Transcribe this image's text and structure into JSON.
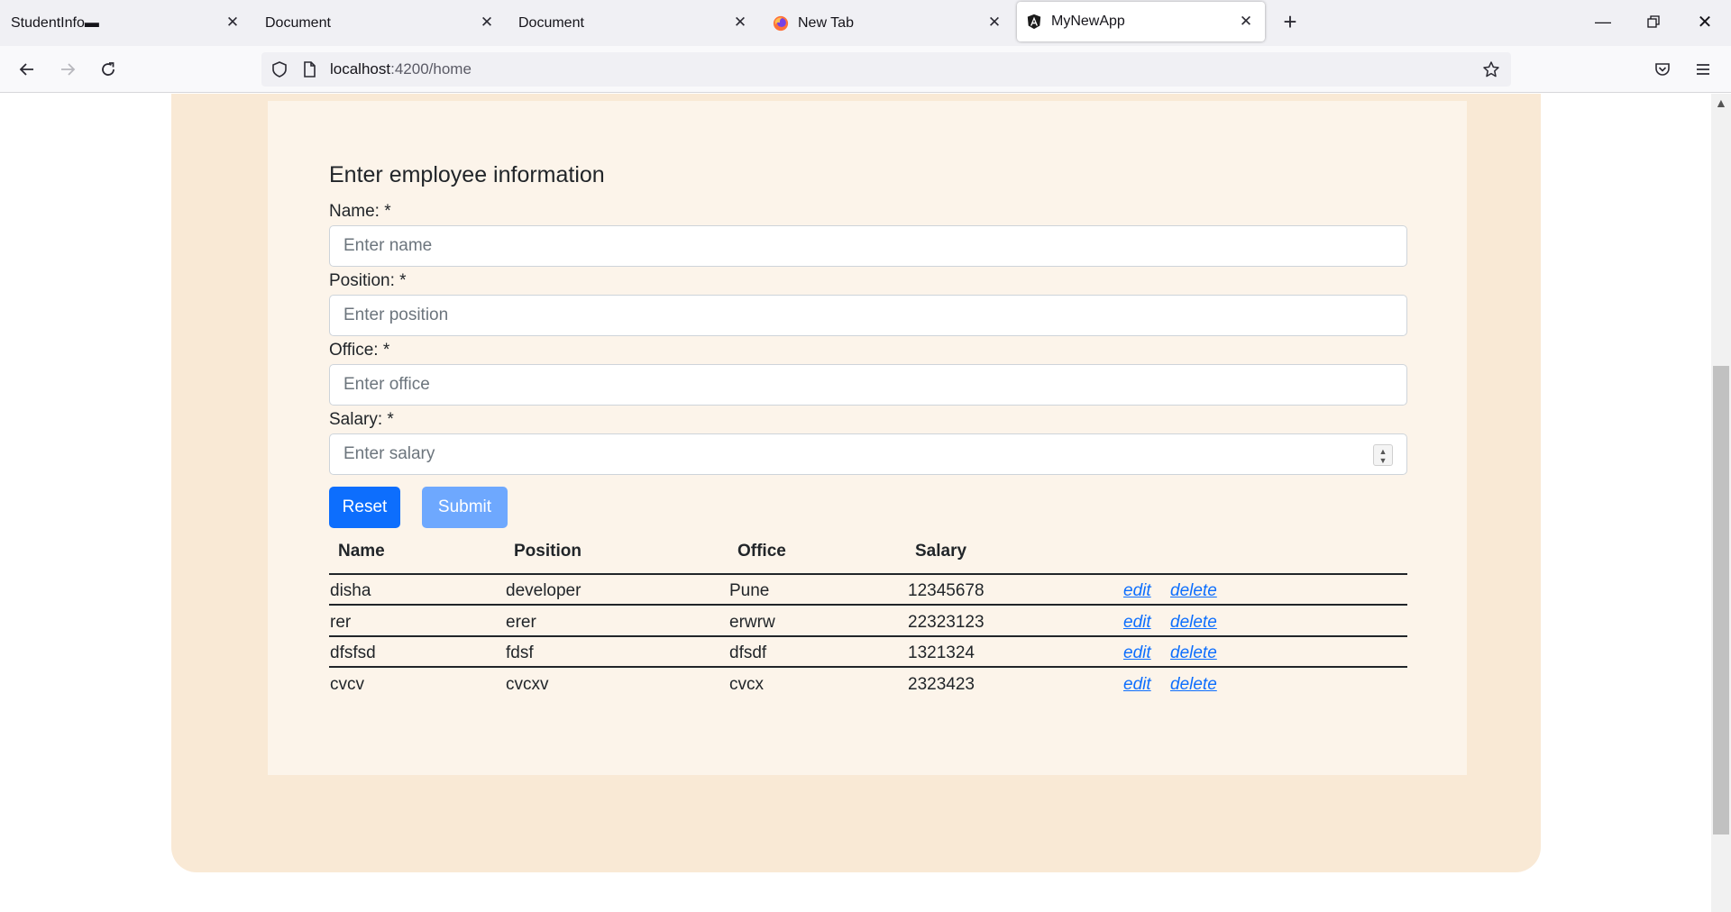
{
  "browser": {
    "tabs": [
      {
        "title": "StudentInfo▬",
        "active": false
      },
      {
        "title": "Document",
        "active": false
      },
      {
        "title": "Document",
        "active": false
      },
      {
        "title": "New Tab",
        "active": false
      },
      {
        "title": "MyNewApp",
        "active": true
      }
    ],
    "url_host": "localhost",
    "url_path": ":4200/home"
  },
  "form": {
    "title": "Enter employee information",
    "fields": [
      {
        "label": "Name: *",
        "placeholder": "Enter name"
      },
      {
        "label": "Position: *",
        "placeholder": "Enter position"
      },
      {
        "label": "Office: *",
        "placeholder": "Enter office"
      },
      {
        "label": "Salary: *",
        "placeholder": "Enter salary"
      }
    ],
    "reset_label": "Reset",
    "submit_label": "Submit"
  },
  "table": {
    "headers": [
      "Name",
      "Position",
      "Office",
      "Salary"
    ],
    "edit_label": "edit",
    "delete_label": "delete",
    "rows": [
      [
        "disha",
        "developer",
        "Pune",
        "12345678"
      ],
      [
        "rer",
        "erer",
        "erwrw",
        "22323123"
      ],
      [
        "dfsfsd",
        "fdsf",
        "dfsdf",
        "1321324"
      ],
      [
        "cvcv",
        "cvcxv",
        "cvcx",
        "2323423"
      ]
    ]
  },
  "colors": {
    "primary": "#0d6efd",
    "primary_disabled": "#6ea8fe",
    "outer_card": "#f9e9d5",
    "inner_card": "#fcf4ea"
  }
}
